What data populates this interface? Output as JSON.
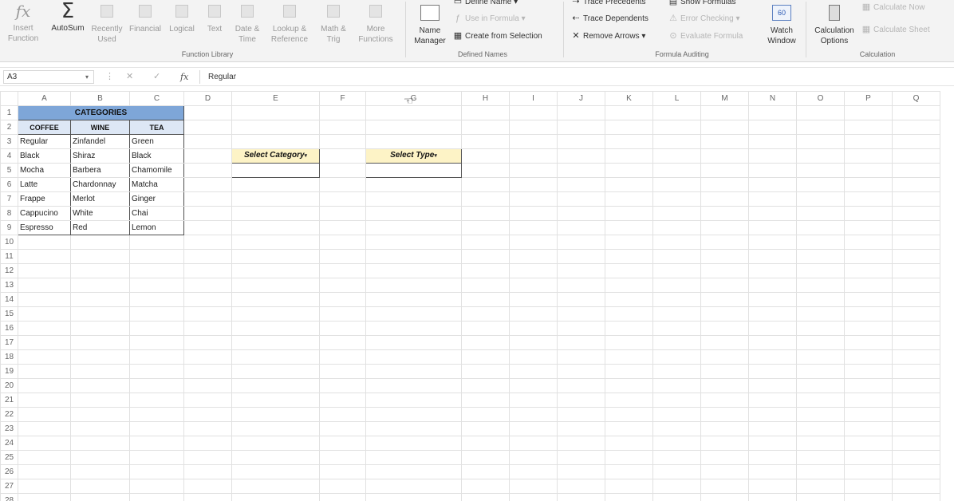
{
  "ribbon": {
    "function_library": {
      "insert_function": "Insert Function",
      "autosum": "AutoSum",
      "recently_used": "Recently Used",
      "financial": "Financial",
      "logical": "Logical",
      "text": "Text",
      "date_time": "Date & Time",
      "lookup_reference": "Lookup & Reference",
      "math_trig": "Math & Trig",
      "more_functions": "More Functions",
      "group_label": "Function Library"
    },
    "defined_names": {
      "name_manager": "Name Manager",
      "define_name": "Define Name",
      "use_in_formula": "Use in Formula",
      "create_from_selection": "Create from Selection",
      "group_label": "Defined Names"
    },
    "formula_auditing": {
      "trace_precedents": "Trace Precedents",
      "trace_dependents": "Trace Dependents",
      "remove_arrows": "Remove Arrows",
      "show_formulas": "Show Formulas",
      "error_checking": "Error Checking",
      "evaluate_formula": "Evaluate Formula",
      "watch_window": "Watch Window",
      "group_label": "Formula Auditing"
    },
    "calculation": {
      "calculation_options": "Calculation Options",
      "calculate_now": "Calculate Now",
      "calculate_sheet": "Calculate Sheet",
      "group_label": "Calculation"
    }
  },
  "formula_bar": {
    "name_box": "A3",
    "formula": "Regular"
  },
  "columns": [
    "A",
    "B",
    "C",
    "D",
    "E",
    "F",
    "G",
    "H",
    "I",
    "J",
    "K",
    "L",
    "M",
    "N",
    "O",
    "P",
    "Q"
  ],
  "rows": [
    "1",
    "2",
    "3",
    "4",
    "5",
    "6",
    "7",
    "8",
    "9",
    "10",
    "11",
    "12",
    "13",
    "14",
    "15",
    "16",
    "17",
    "18",
    "19",
    "20",
    "21",
    "22",
    "23",
    "24",
    "25",
    "26",
    "27",
    "28"
  ],
  "table": {
    "title": "CATEGORIES",
    "headers": [
      "COFFEE",
      "WINE",
      "TEA"
    ],
    "data": [
      [
        "Regular",
        "Zinfandel",
        "Green"
      ],
      [
        "Black",
        "Shiraz",
        "Black"
      ],
      [
        "Mocha",
        "Barbera",
        "Chamomile"
      ],
      [
        "Latte",
        "Chardonnay",
        "Matcha"
      ],
      [
        "Frappe",
        "Merlot",
        "Ginger"
      ],
      [
        "Cappucino",
        "White",
        "Chai"
      ],
      [
        "Espresso",
        "Red",
        "Lemon"
      ]
    ]
  },
  "dropdowns": {
    "category_label": "Select Category",
    "type_label": "Select Type"
  },
  "colors": {
    "table_title_bg": "#7ea6d8",
    "table_header_bg": "#dde7f5",
    "dropdown_label_bg": "#fdf3c6"
  }
}
